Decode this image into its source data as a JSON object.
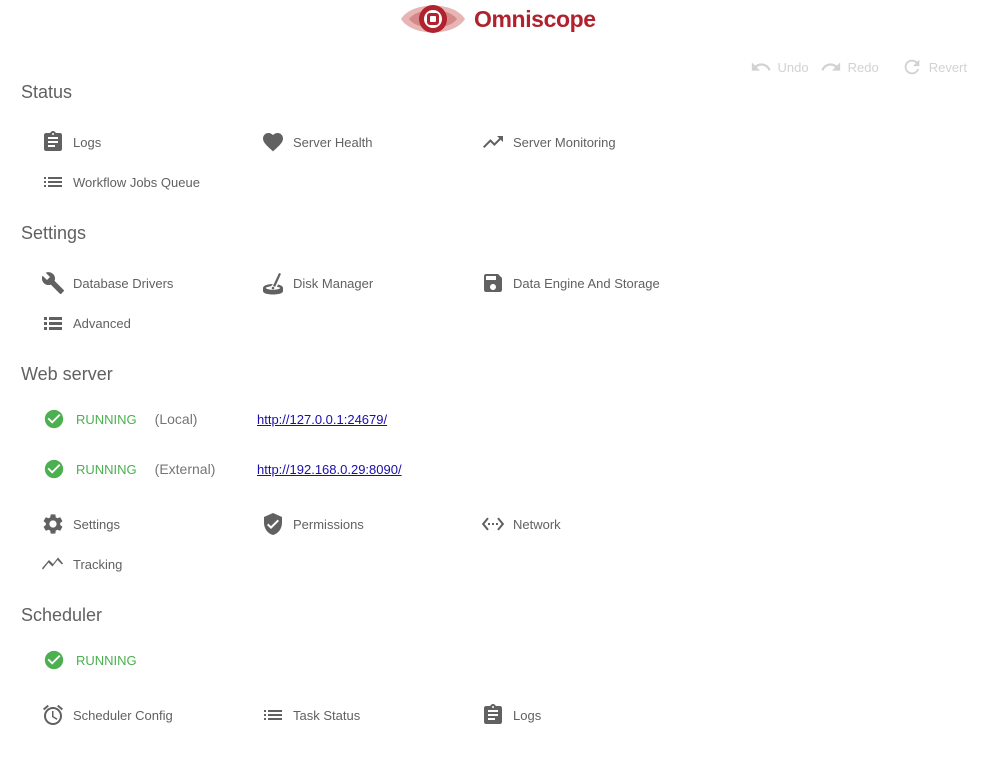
{
  "app": {
    "name": "Omniscope"
  },
  "toolbar": {
    "undo": "Undo",
    "redo": "Redo",
    "revert": "Revert"
  },
  "status": {
    "title": "Status",
    "items": [
      {
        "label": "Logs",
        "icon": "clipboard-icon"
      },
      {
        "label": "Server Health",
        "icon": "heart-icon"
      },
      {
        "label": "Server Monitoring",
        "icon": "trending-up-icon"
      },
      {
        "label": "Workflow Jobs Queue",
        "icon": "list-icon"
      }
    ]
  },
  "settings": {
    "title": "Settings",
    "items": [
      {
        "label": "Database Drivers",
        "icon": "wrench-icon"
      },
      {
        "label": "Disk Manager",
        "icon": "disk-manager-icon"
      },
      {
        "label": "Data Engine And Storage",
        "icon": "save-icon"
      },
      {
        "label": "Advanced",
        "icon": "view-list-icon"
      }
    ]
  },
  "webserver": {
    "title": "Web server",
    "servers": [
      {
        "status": "RUNNING",
        "location": "(Local)",
        "url": "http://127.0.0.1:24679/"
      },
      {
        "status": "RUNNING",
        "location": "(External)",
        "url": "http://192.168.0.29:8090/"
      }
    ],
    "items": [
      {
        "label": "Settings",
        "icon": "gear-icon"
      },
      {
        "label": "Permissions",
        "icon": "shield-check-icon"
      },
      {
        "label": "Network",
        "icon": "network-icon"
      },
      {
        "label": "Tracking",
        "icon": "tracking-icon"
      }
    ]
  },
  "scheduler": {
    "title": "Scheduler",
    "status": "RUNNING",
    "items": [
      {
        "label": "Scheduler Config",
        "icon": "alarm-clock-icon"
      },
      {
        "label": "Task Status",
        "icon": "list-icon"
      },
      {
        "label": "Logs",
        "icon": "clipboard-icon"
      }
    ]
  },
  "colors": {
    "brand": "#b0222e",
    "running": "#4caf50",
    "text": "#616161",
    "disabled": "#d2d2d2",
    "link": "#1a0dab"
  }
}
